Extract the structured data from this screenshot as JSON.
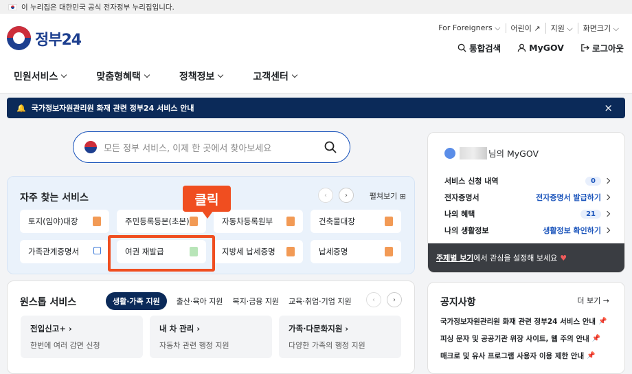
{
  "topbar": {
    "text": "이 누리집은 대한민국 공식 전자정부 누리집입니다."
  },
  "logo": {
    "text": "정부24"
  },
  "util": [
    "For Foreigners ⌵",
    "어린이 ↗",
    "지원 ⌵",
    "화면크기 ⌵"
  ],
  "actions": {
    "search": "통합검색",
    "mygov": "MyGOV",
    "logout": "로그아웃"
  },
  "gnb": [
    "민원서비스",
    "맞춤형혜택",
    "정책정보",
    "고객센터"
  ],
  "notice_bar": {
    "text": "국가정보자원관리원 화재 관련 정부24 서비스 안내",
    "close": "×"
  },
  "search": {
    "placeholder": "모든 정부 서비스, 이제 한 곳에서 찾아보세요"
  },
  "favorites": {
    "title": "자주 찾는 서비스",
    "expand": "펼쳐보기 ⊞",
    "items": [
      "토지(임야)대장",
      "주민등록등본(초본)",
      "자동차등록원부",
      "건축물대장",
      "가족관계증명서",
      "여권 재발급",
      "지방세 납세증명",
      "납세증명"
    ]
  },
  "callout": {
    "text": "클릭"
  },
  "onestop": {
    "title": "원스톱 서비스",
    "tabs": [
      "생활·가족 지원",
      "출산·육아 지원",
      "복지·금융 지원",
      "교육·취업·기업 지원"
    ],
    "cards": [
      {
        "title": "전입신고+ ›",
        "desc": "한번에 여러 감면 신청"
      },
      {
        "title": "내 차 관리 ›",
        "desc": "자동차 관련 행정 지원"
      },
      {
        "title": "가족·다문화지원 ›",
        "desc": "다양한 가족의 행정 지원"
      }
    ]
  },
  "mygov": {
    "suffix": "님의 MyGOV",
    "rows": [
      {
        "label": "서비스 신청 내역",
        "value": "0"
      },
      {
        "label": "전자증명서",
        "value": "전자증명서 발급하기"
      },
      {
        "label": "나의 혜택",
        "value": "21"
      },
      {
        "label": "나의 생활정보",
        "value": "생활정보 확인하기"
      }
    ],
    "footer_link": "주제별 보기",
    "footer_text": "에서 관심을 설정해 보세요"
  },
  "notices": {
    "title": "공지사항",
    "more": "더 보기 →",
    "items": [
      "국가정보자원관리원 화재 관련 정부24 서비스 안내",
      "피싱 문자 및 공공기관 위장 사이트, 웹 주의 안내",
      "매크로 및 유사 프로그램 사용자 이용 제한 안내"
    ]
  }
}
